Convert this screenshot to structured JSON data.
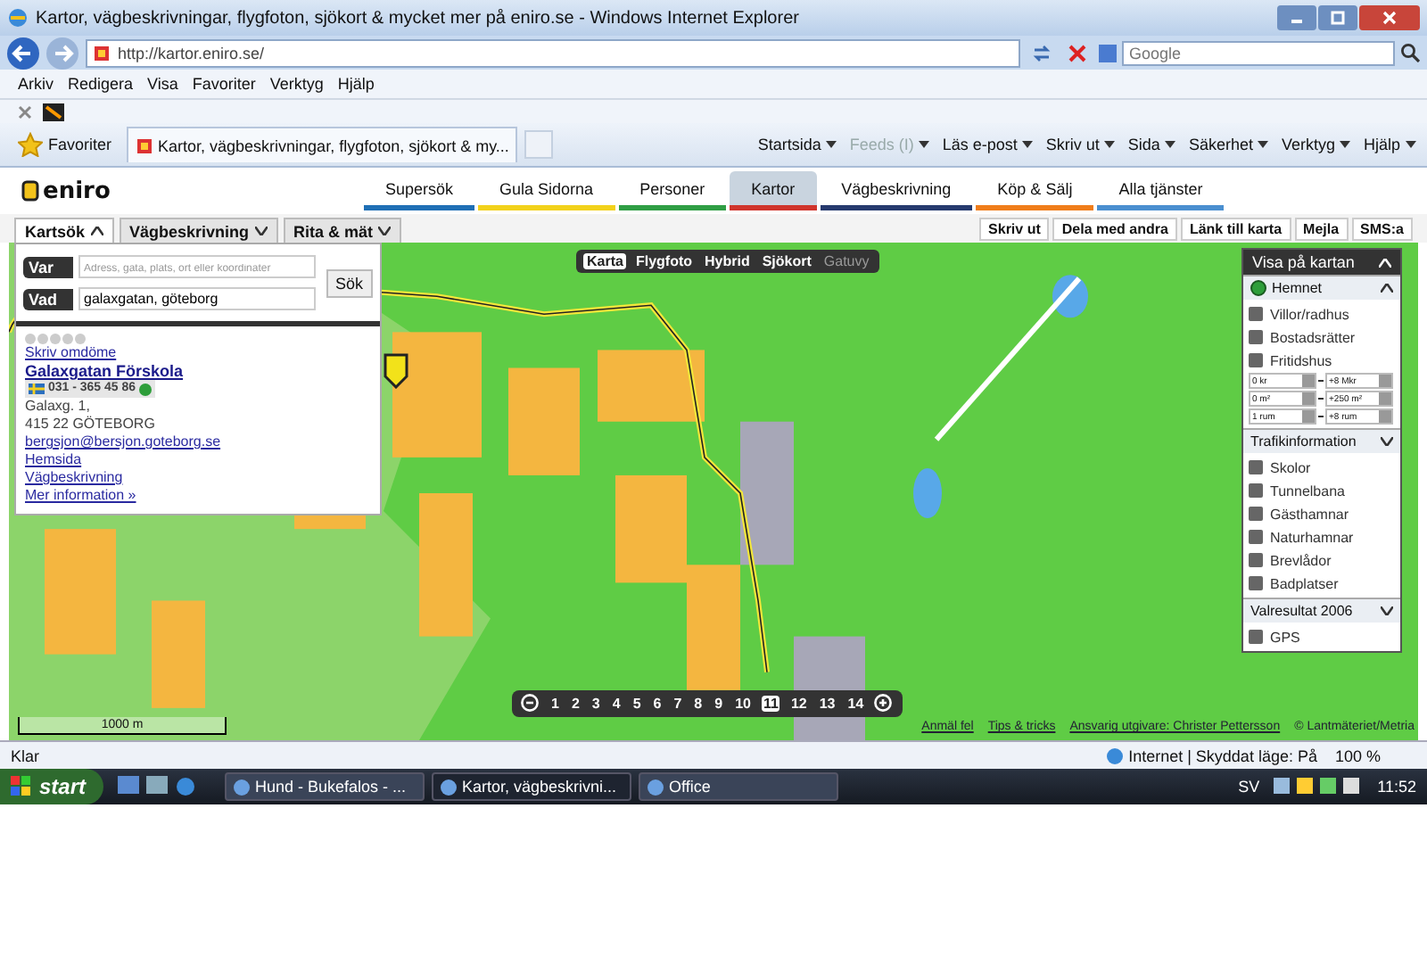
{
  "browser": {
    "title": "Kartor, vägbeskrivningar, flygfoton, sjökort & mycket mer på eniro.se - Windows Internet Explorer",
    "address": "http://kartor.eniro.se/",
    "search_placeholder": "Google",
    "menu": [
      "Arkiv",
      "Redigera",
      "Visa",
      "Favoriter",
      "Verktyg",
      "Hjälp"
    ],
    "favorites_label": "Favoriter",
    "tab_title": "Kartor, vägbeskrivningar, flygfoton, sjökort & my...",
    "commands": [
      {
        "label": "Startsida",
        "disabled": false
      },
      {
        "label": "Feeds (I)",
        "disabled": true
      },
      {
        "label": "Läs e-post",
        "disabled": false
      },
      {
        "label": "Skriv ut",
        "disabled": false
      },
      {
        "label": "Sida",
        "disabled": false
      },
      {
        "label": "Säkerhet",
        "disabled": false
      },
      {
        "label": "Verktyg",
        "disabled": false
      },
      {
        "label": "Hjälp",
        "disabled": false
      }
    ]
  },
  "site": {
    "logo": "eniro",
    "nav": [
      {
        "label": "Supersök",
        "selected": false,
        "color": "#1f6fb5"
      },
      {
        "label": "Gula Sidorna",
        "selected": false,
        "color": "#f2d21b"
      },
      {
        "label": "Personer",
        "selected": false,
        "color": "#2f9e44"
      },
      {
        "label": "Kartor",
        "selected": true,
        "color": "#d0342c"
      },
      {
        "label": "Vägbeskrivning",
        "selected": false,
        "color": "#263a6e"
      },
      {
        "label": "Köp & Sälj",
        "selected": false,
        "color": "#f07d1a"
      },
      {
        "label": "Alla tjänster",
        "selected": false,
        "color": "#4a8fd0"
      }
    ],
    "search_tabs": [
      {
        "label": "Kartsök",
        "selected": true
      },
      {
        "label": "Vägbeskrivning",
        "selected": false
      },
      {
        "label": "Rita & mät",
        "selected": false
      }
    ],
    "actions": [
      "Skriv ut",
      "Dela med andra",
      "Länk till karta",
      "Mejla",
      "SMS:a"
    ]
  },
  "search": {
    "fields": [
      {
        "label": "Var",
        "placeholder": "Adress, gata, plats, ort eller koordinater"
      },
      {
        "label": "Vad",
        "value": "galaxgatan, göteborg"
      }
    ],
    "button": "Sök"
  },
  "result": {
    "stars": 0,
    "review_link": "Skriv omdöme",
    "name": "Galaxgatan Förskola",
    "phone": "031 - 365 45 86",
    "address_lines": [
      "Galaxg. 1,",
      "415 22 GÖTEBORG"
    ],
    "links": [
      "bergsjon@bersjon.goteborg.se",
      "Hemsida",
      "Vägbeskrivning",
      "Mer information »"
    ]
  },
  "map_types": [
    {
      "label": "Karta",
      "selected": true,
      "disabled": false
    },
    {
      "label": "Flygfoto",
      "selected": false,
      "disabled": false
    },
    {
      "label": "Hybrid",
      "selected": false,
      "disabled": false
    },
    {
      "label": "Sjökort",
      "selected": false,
      "disabled": false
    },
    {
      "label": "Gatuvy",
      "selected": false,
      "disabled": true
    }
  ],
  "layers": {
    "title": "Visa på kartan",
    "sections": [
      {
        "title": "Hemnet",
        "expanded": true,
        "items": [
          "Villor/radhus",
          "Bostadsrätter",
          "Fritidshus"
        ],
        "filters": [
          [
            "0 kr",
            "+8 Mkr"
          ],
          [
            "0 m²",
            "+250 m²"
          ],
          [
            "1 rum",
            "+8 rum"
          ]
        ]
      },
      {
        "title": "Trafikinformation",
        "expanded": false,
        "items": [
          "Skolor",
          "Tunnelbana",
          "Gästhamnar",
          "Naturhamnar",
          "Brevlådor",
          "Badplatser"
        ]
      },
      {
        "title": "Valresultat 2006",
        "expanded": false,
        "items": [
          "GPS"
        ]
      }
    ]
  },
  "zoom_levels": [
    {
      "label": "1",
      "selected": false
    },
    {
      "label": "2",
      "selected": false
    },
    {
      "label": "3",
      "selected": false
    },
    {
      "label": "4",
      "selected": false
    },
    {
      "label": "5",
      "selected": false
    },
    {
      "label": "6",
      "selected": false
    },
    {
      "label": "7",
      "selected": false
    },
    {
      "label": "8",
      "selected": false
    },
    {
      "label": "9",
      "selected": false
    },
    {
      "label": "10",
      "selected": false
    },
    {
      "label": "11",
      "selected": true
    },
    {
      "label": "12",
      "selected": false
    },
    {
      "label": "13",
      "selected": false
    },
    {
      "label": "14",
      "selected": false
    }
  ],
  "scale": "1000 m",
  "attribution": [
    "Anmäl fel",
    "Tips & tricks",
    "Ansvarig utgivare: Christer Pettersson",
    "© Lantmäteriet/Metria"
  ],
  "status": {
    "text": "Klar",
    "zone": "Internet | Skyddat läge: På",
    "zoom": "100 %"
  },
  "taskbar": {
    "start": "start",
    "tasks": [
      {
        "label": "Hund - Bukefalos - ...",
        "selected": false
      },
      {
        "label": "Kartor, vägbeskrivni...",
        "selected": true
      },
      {
        "label": "Office",
        "selected": false
      }
    ],
    "lang": "SV",
    "clock": "11:52"
  }
}
